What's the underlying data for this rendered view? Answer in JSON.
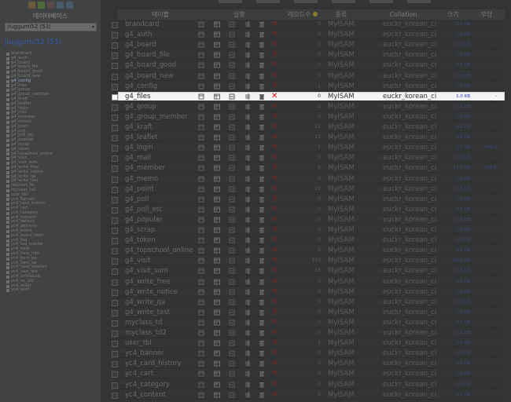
{
  "sidebar": {
    "db_heading": "데이터베이스",
    "db_select_value": "jiuggumi52 (53)",
    "db_name": "jiuggumi52",
    "db_count": "(53)",
    "tables": [
      "brandcard",
      "g4_auth",
      "g4_board",
      "g4_board_file",
      "g4_board_good",
      "g4_board_new",
      "g4_config",
      "g4_files",
      "g4_group",
      "g4_group_member",
      "g4_kraft",
      "g4_leaflet",
      "g4_login",
      "g4_mail",
      "g4_member",
      "g4_memo",
      "g4_point",
      "g4_poll",
      "g4_poll_etc",
      "g4_popular",
      "g4_scrap",
      "g4_token",
      "g4_topschool_online",
      "g4_visit",
      "g4_visit_sum",
      "g4_write_free",
      "g4_write_notice",
      "g4_write_qa",
      "g4_write_test",
      "myclass_td",
      "myclass_td2",
      "user_tbl",
      "yc4_banner",
      "yc4_card_history",
      "yc4_cart",
      "yc4_category",
      "yc4_content",
      "yc4_default",
      "yc4_delivery",
      "yc4_event",
      "yc4_event_item",
      "yc4_faq",
      "yc4_faq_master",
      "yc4_item",
      "yc4_item_info",
      "yc4_item_ps",
      "yc4_item_qa",
      "yc4_item_relation",
      "yc4_new_win",
      "yc4_onlinecalc",
      "yc4_on_uid",
      "yc4_order",
      "yc4_wish"
    ],
    "active_table": "g4_config"
  },
  "header": {
    "table": "테이블",
    "action": "실행",
    "records": "레코드수",
    "type": "종류",
    "collation": "Collation",
    "size": "크기",
    "overhead": "부담"
  },
  "rows": [
    {
      "name": "brandcard",
      "records": "0",
      "engine": "MyISAM",
      "collation": "euckr_korean_ci",
      "size": "1.0 KB",
      "overhead": "-"
    },
    {
      "name": "g4_auth",
      "records": "0",
      "engine": "MyISAM",
      "collation": "euckr_korean_ci",
      "size": "1.0 KB",
      "overhead": "-"
    },
    {
      "name": "g4_board",
      "records": "1",
      "engine": "MyISAM",
      "collation": "euckr_korean_ci",
      "size": "2.1 KB",
      "overhead": "-"
    },
    {
      "name": "g4_board_file",
      "records": "0",
      "engine": "MyISAM",
      "collation": "euckr_korean_ci",
      "size": "1.0 KB",
      "overhead": "-"
    },
    {
      "name": "g4_board_good",
      "records": "0",
      "engine": "MyISAM",
      "collation": "euckr_korean_ci",
      "size": "1.0 KB",
      "overhead": "-"
    },
    {
      "name": "g4_board_new",
      "records": "0",
      "engine": "MyISAM",
      "collation": "euckr_korean_ci",
      "size": "1.0 KB",
      "overhead": "-"
    },
    {
      "name": "g4_config",
      "records": "1",
      "engine": "MyISAM",
      "collation": "euckr_korean_ci",
      "size": "2.3 KB",
      "overhead": "-"
    },
    {
      "name": "g4_files",
      "records": "0",
      "engine": "MyISAM",
      "collation": "euckr_korean_ci",
      "size": "1.0 KB",
      "overhead": "-",
      "highlight": true
    },
    {
      "name": "g4_group",
      "records": "1",
      "engine": "MyISAM",
      "collation": "euckr_korean_ci",
      "size": "2.1 KB",
      "overhead": "-"
    },
    {
      "name": "g4_group_member",
      "records": "0",
      "engine": "MyISAM",
      "collation": "euckr_korean_ci",
      "size": "1.0 KB",
      "overhead": "-"
    },
    {
      "name": "g4_kraft",
      "records": "12",
      "engine": "MyISAM",
      "collation": "euckr_korean_ci",
      "size": "4.2 KB",
      "overhead": "-"
    },
    {
      "name": "g4_leaflet",
      "records": "13",
      "engine": "MyISAM",
      "collation": "euckr_korean_ci",
      "size": "3.6 KB",
      "overhead": "-"
    },
    {
      "name": "g4_login",
      "records": "1",
      "engine": "MyISAM",
      "collation": "euckr_korean_ci",
      "size": "3.7 KB",
      "overhead": "640 B"
    },
    {
      "name": "g4_mail",
      "records": "0",
      "engine": "MyISAM",
      "collation": "euckr_korean_ci",
      "size": "1.0 KB",
      "overhead": "-"
    },
    {
      "name": "g4_member",
      "records": "2",
      "engine": "MyISAM",
      "collation": "euckr_korean_ci",
      "size": "11.5 KB",
      "overhead": "136 B"
    },
    {
      "name": "g4_memo",
      "records": "0",
      "engine": "MyISAM",
      "collation": "euckr_korean_ci",
      "size": "1.0 KB",
      "overhead": "-"
    },
    {
      "name": "g4_point",
      "records": "19",
      "engine": "MyISAM",
      "collation": "euckr_korean_ci",
      "size": "5.6 KB",
      "overhead": "-"
    },
    {
      "name": "g4_poll",
      "records": "0",
      "engine": "MyISAM",
      "collation": "euckr_korean_ci",
      "size": "1.0 KB",
      "overhead": "-"
    },
    {
      "name": "g4_poll_etc",
      "records": "0",
      "engine": "MyISAM",
      "collation": "euckr_korean_ci",
      "size": "1.0 KB",
      "overhead": "-"
    },
    {
      "name": "g4_popular",
      "records": "0",
      "engine": "MyISAM",
      "collation": "euckr_korean_ci",
      "size": "1.0 KB",
      "overhead": "-"
    },
    {
      "name": "g4_scrap",
      "records": "0",
      "engine": "MyISAM",
      "collation": "euckr_korean_ci",
      "size": "1.0 KB",
      "overhead": "-"
    },
    {
      "name": "g4_token",
      "records": "0",
      "engine": "MyISAM",
      "collation": "euckr_korean_ci",
      "size": "1.0 KB",
      "overhead": "-"
    },
    {
      "name": "g4_topschool_online",
      "records": "2",
      "engine": "MyISAM",
      "collation": "euckr_korean_ci",
      "size": "3.3 KB",
      "overhead": "-"
    },
    {
      "name": "g4_visit",
      "records": "133",
      "engine": "MyISAM",
      "collation": "euckr_korean_ci",
      "size": "24.2 KB",
      "overhead": "-"
    },
    {
      "name": "g4_visit_sum",
      "records": "16",
      "engine": "MyISAM",
      "collation": "euckr_korean_ci",
      "size": "1.5 KB",
      "overhead": "-"
    },
    {
      "name": "g4_write_free",
      "records": "0",
      "engine": "MyISAM",
      "collation": "euckr_korean_ci",
      "size": "1.0 KB",
      "overhead": "-"
    },
    {
      "name": "g4_write_notice",
      "records": "0",
      "engine": "MyISAM",
      "collation": "euckr_korean_ci",
      "size": "1.0 KB",
      "overhead": "-"
    },
    {
      "name": "g4_write_qa",
      "records": "0",
      "engine": "MyISAM",
      "collation": "euckr_korean_ci",
      "size": "1.0 KB",
      "overhead": "-"
    },
    {
      "name": "g4_write_test",
      "records": "0",
      "engine": "MyISAM",
      "collation": "euckr_korean_ci",
      "size": "1.0 KB",
      "overhead": "-"
    },
    {
      "name": "myclass_td",
      "records": "0",
      "engine": "MyISAM",
      "collation": "euckr_korean_ci",
      "size": "2.1 KB",
      "overhead": "-"
    },
    {
      "name": "myclass_td2",
      "records": "0",
      "engine": "MyISAM",
      "collation": "euckr_korean_ci",
      "size": "2.1 KB",
      "overhead": "-"
    },
    {
      "name": "user_tbl",
      "records": "4",
      "engine": "MyISAM",
      "collation": "euckr_korean_ci",
      "size": "2.1 KB",
      "overhead": "-"
    },
    {
      "name": "yc4_banner",
      "records": "0",
      "engine": "MyISAM",
      "collation": "euckr_korean_ci",
      "size": "1.0 KB",
      "overhead": "-"
    },
    {
      "name": "yc4_card_history",
      "records": "0",
      "engine": "MyISAM",
      "collation": "euckr_korean_ci",
      "size": "1.0 KB",
      "overhead": "-"
    },
    {
      "name": "yc4_cart",
      "records": "0",
      "engine": "MyISAM",
      "collation": "euckr_korean_ci",
      "size": "1.0 KB",
      "overhead": "-"
    },
    {
      "name": "yc4_category",
      "records": "0",
      "engine": "MyISAM",
      "collation": "euckr_korean_ci",
      "size": "1.0 KB",
      "overhead": "-"
    },
    {
      "name": "yc4_content",
      "records": "5",
      "engine": "MyISAM",
      "collation": "euckr_korean_ci",
      "size": "2.1 KB",
      "overhead": "-"
    }
  ],
  "colors": {
    "highlight_row": "#f4f4f4",
    "size_link": "#1b2fc9",
    "drop_icon": "#d01010",
    "db_name": "#3658a8"
  },
  "icons": [
    "browse-icon",
    "structure-icon",
    "search-icon",
    "insert-icon",
    "empty-icon",
    "drop-icon"
  ]
}
